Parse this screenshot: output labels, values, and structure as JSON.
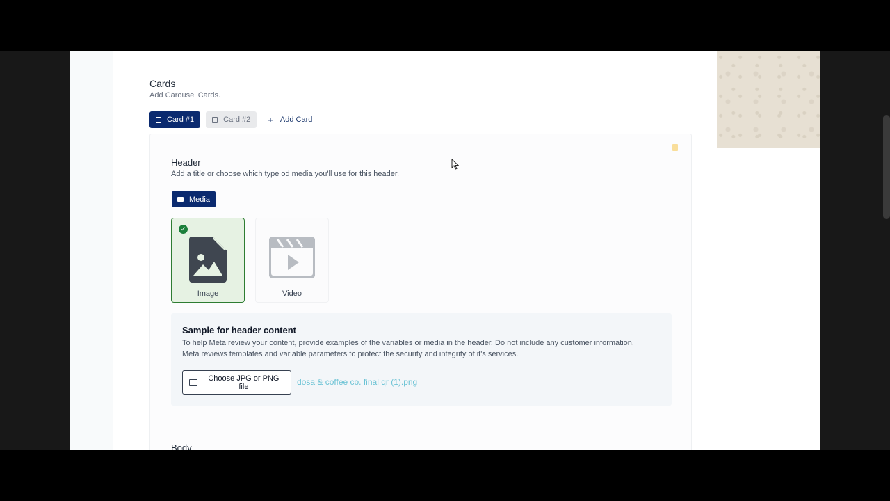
{
  "cards": {
    "title": "Cards",
    "subtitle": "Add Carousel Cards.",
    "tabs": [
      {
        "label": "Card #1",
        "active": true
      },
      {
        "label": "Card #2",
        "active": false
      }
    ],
    "add_card_label": "Add Card"
  },
  "header": {
    "title": "Header",
    "subtitle": "Add a title or choose which type od media you'll use for this header.",
    "media_button_label": "Media",
    "options": [
      {
        "label": "Image",
        "selected": true,
        "icon": "image-file-icon"
      },
      {
        "label": "Video",
        "selected": false,
        "icon": "video-clapper-icon"
      }
    ]
  },
  "sample": {
    "title": "Sample for header content",
    "description": "To help Meta review your content, provide examples of the variables or media in the header. Do not include any customer information. Meta reviews templates and variable parameters to protect the security and integrity of it's services.",
    "choose_button_label": "Choose JPG or PNG file",
    "file_name": "dosa & coffee co. final qr (1).png"
  },
  "body": {
    "title": "Body"
  },
  "colors": {
    "primary": "#0b2a6f",
    "selected_bg": "#e6f2e3",
    "selected_border": "#2e7d32",
    "file_link": "#6cc3d5"
  }
}
